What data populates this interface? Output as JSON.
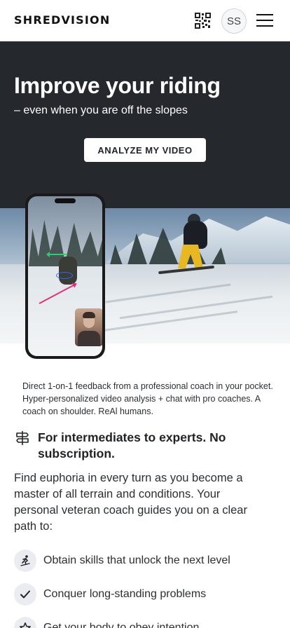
{
  "header": {
    "logo_text": "SHREDVISION",
    "qr_icon": "qr-code-icon",
    "avatar_initials": "SS",
    "menu_icon": "hamburger-menu-icon"
  },
  "hero": {
    "title": "Improve your riding",
    "subtitle": "– even when you are off the slopes",
    "cta_label": "ANALYZE MY VIDEO",
    "background_color": "#25292e"
  },
  "main": {
    "caption": "Direct 1-on-1 feedback from a professional coach in your pocket. Hyper-personalized video analysis + chat with pro coaches. A coach on shoulder. ReAl humans.",
    "feature": {
      "icon": "signpost-icon",
      "title": "For intermediates to experts. No subscription."
    },
    "body": "Find euphoria in every turn as you become a master of all terrain and conditions. Your personal veteran coach guides you on a clear path to:",
    "list": [
      {
        "icon": "skier-icon",
        "label": "Obtain skills that unlock the next level"
      },
      {
        "icon": "checkmark-icon",
        "label": "Conquer long-standing problems"
      },
      {
        "icon": "star-icon",
        "label": "Get your body to obey intention"
      }
    ]
  }
}
